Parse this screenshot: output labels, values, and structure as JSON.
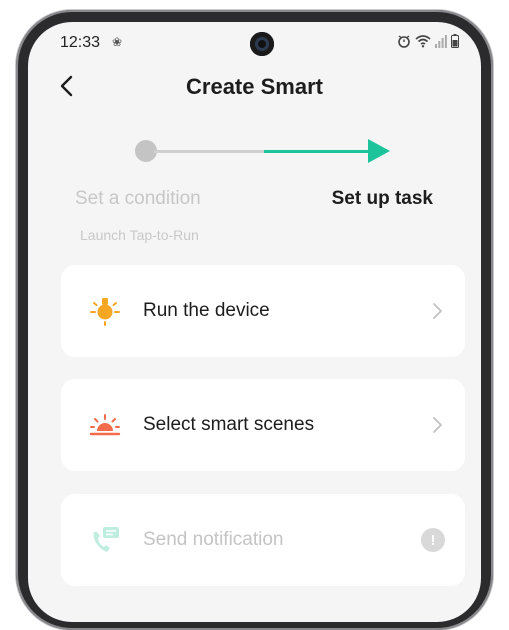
{
  "status_bar": {
    "time": "12:33",
    "gear_glyph": "❀",
    "icons": [
      "alarm-icon",
      "wifi-icon",
      "signal-icon",
      "battery-icon"
    ]
  },
  "header": {
    "back_icon": "chevron-left-icon",
    "title": "Create Smart"
  },
  "stepper": {
    "steps": [
      {
        "label": "Set a condition",
        "state": "done"
      },
      {
        "label": "Set up task",
        "state": "active"
      }
    ],
    "sublabel": "Launch Tap-to-Run",
    "accent_color": "#1dc49b"
  },
  "tasks": [
    {
      "label": "Run the device",
      "icon": "bulb-icon",
      "icon_color": "#f5a623",
      "enabled": true
    },
    {
      "label": "Select smart scenes",
      "icon": "sunset-icon",
      "icon_color": "#f26b4a",
      "enabled": true
    },
    {
      "label": "Send notification",
      "icon": "notification-phone-icon",
      "icon_color": "#bfeee0",
      "enabled": false
    }
  ],
  "info_badge": "!"
}
